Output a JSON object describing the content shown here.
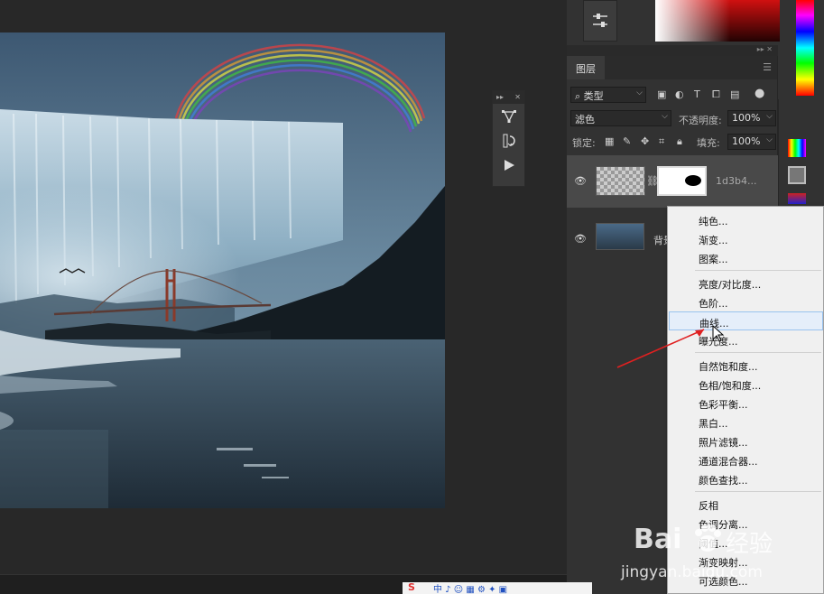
{
  "canvas": {
    "image_name": "waterfall-bridge-rainbow-composite"
  },
  "mini_panel": {
    "header_left": "▸▸",
    "header_right": "✕"
  },
  "layers_panel": {
    "tab_label": "图层",
    "filter_type": "类型",
    "blend_mode": "滤色",
    "opacity_label": "不透明度:",
    "opacity_value": "100%",
    "lock_label": "锁定:",
    "fill_label": "填充:",
    "fill_value": "100%",
    "layers": [
      {
        "name": "1d3b4...",
        "visible": true,
        "active": true
      },
      {
        "name": "背景",
        "visible": true,
        "active": false
      }
    ]
  },
  "context_menu": {
    "items": [
      {
        "label": "纯色...",
        "group": 1
      },
      {
        "label": "渐变...",
        "group": 1
      },
      {
        "label": "图案...",
        "group": 1
      },
      {
        "label": "亮度/对比度...",
        "group": 2
      },
      {
        "label": "色阶...",
        "group": 2
      },
      {
        "label": "曲线...",
        "group": 2,
        "highlighted": true
      },
      {
        "label": "曝光度...",
        "group": 2
      },
      {
        "label": "自然饱和度...",
        "group": 3
      },
      {
        "label": "色相/饱和度...",
        "group": 3
      },
      {
        "label": "色彩平衡...",
        "group": 3
      },
      {
        "label": "黑白...",
        "group": 3
      },
      {
        "label": "照片滤镜...",
        "group": 3
      },
      {
        "label": "通道混合器...",
        "group": 3
      },
      {
        "label": "颜色查找...",
        "group": 3
      },
      {
        "label": "反相",
        "group": 4
      },
      {
        "label": "色调分离...",
        "group": 4
      },
      {
        "label": "阈值...",
        "group": 4
      },
      {
        "label": "渐变映射...",
        "group": 4
      },
      {
        "label": "可选颜色...",
        "group": 4
      }
    ]
  },
  "watermark": {
    "brand": "Bai",
    "brand_cn": "经验",
    "url": "jingyan.baidu.com"
  },
  "colors": {
    "accent_arrow": "#e02020",
    "menu_highlight": "#e5eefa",
    "panel_bg": "#323232"
  }
}
